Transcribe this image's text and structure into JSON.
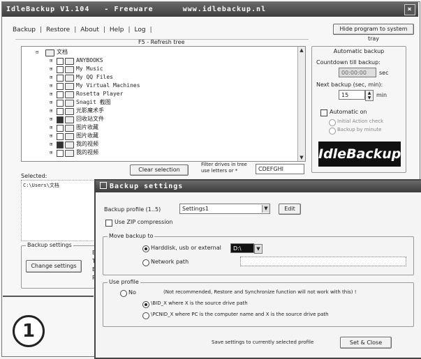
{
  "window": {
    "title": "IdleBackup V1.104   - Freeware      www.idlebackup.nl",
    "close_glyph": "×"
  },
  "header": {
    "hide_button": "Hide program to system tray",
    "refresh_hint": "F5 - Refresh tree"
  },
  "tabs": [
    {
      "label": "Backup"
    },
    {
      "label": "Restore"
    },
    {
      "label": "About"
    },
    {
      "label": "Help"
    },
    {
      "label": "Log"
    }
  ],
  "tab_separator": "|",
  "tree": {
    "root_label": "文档",
    "items": [
      {
        "label": "ANYBOOKS",
        "checked": false
      },
      {
        "label": "My Music",
        "checked": false
      },
      {
        "label": "My QQ Files",
        "checked": false
      },
      {
        "label": "My Virtual Machines",
        "checked": false
      },
      {
        "label": "Rosetta Player",
        "checked": false
      },
      {
        "label": "Snagit 截图",
        "checked": false
      },
      {
        "label": "光影魔术手",
        "checked": false
      },
      {
        "label": "回收站文件",
        "checked": true
      },
      {
        "label": "图片收藏",
        "checked": false
      },
      {
        "label": "图片收藏",
        "checked": false
      },
      {
        "label": "我的视频",
        "checked": true
      },
      {
        "label": "我的视频",
        "checked": false
      }
    ]
  },
  "selection": {
    "clear_button": "Clear selection",
    "filter_label": "Filter drives in tree use letters or *",
    "filter_value": "CDEFGHI",
    "selected_label": "Selected:",
    "selected_value": "C:\\Users\\文档"
  },
  "auto_backup": {
    "title": "Automatic backup",
    "countdown_label": "Countdown till backup:",
    "countdown_value": "00:00:00",
    "countdown_unit": "sec",
    "next_label": "Next backup (sec, min):",
    "next_value": "15",
    "next_unit": "min",
    "auto_on": "Automatic on",
    "opt_after_check": "Initial Action check",
    "opt_after_minutes": "Backup by minute"
  },
  "logo_text": "IdleBackup",
  "backup_settings": {
    "group_label": "Backup settings",
    "change_button": "Change settings",
    "side_labels": [
      "Ba",
      "Ta",
      "Ba",
      "Pr"
    ]
  },
  "step_number": "1",
  "dialog": {
    "title": "Backup settings",
    "profile_label": "Backup profile (1..5)",
    "profile_value": "Settings1",
    "edit_button": "Edit",
    "zip_label": "Use ZIP compression",
    "move_group": "Move backup to",
    "opt_harddisk": "Harddisk, usb or external",
    "drive_value": "D:\\",
    "opt_network": "Network path",
    "network_value": "",
    "profile_group": "Use profile",
    "opt_no": "No",
    "opt_no_note": "(Not recommended, Restore and Synchronize function will not work with this) !",
    "opt_x": "\\BID_X where X is the source drive path",
    "opt_pc": "\\PCNID_X where PC is the computer name and X is the source drive path",
    "save_note": "Save settings to currently selected profile",
    "save_button": "Set & Close"
  }
}
